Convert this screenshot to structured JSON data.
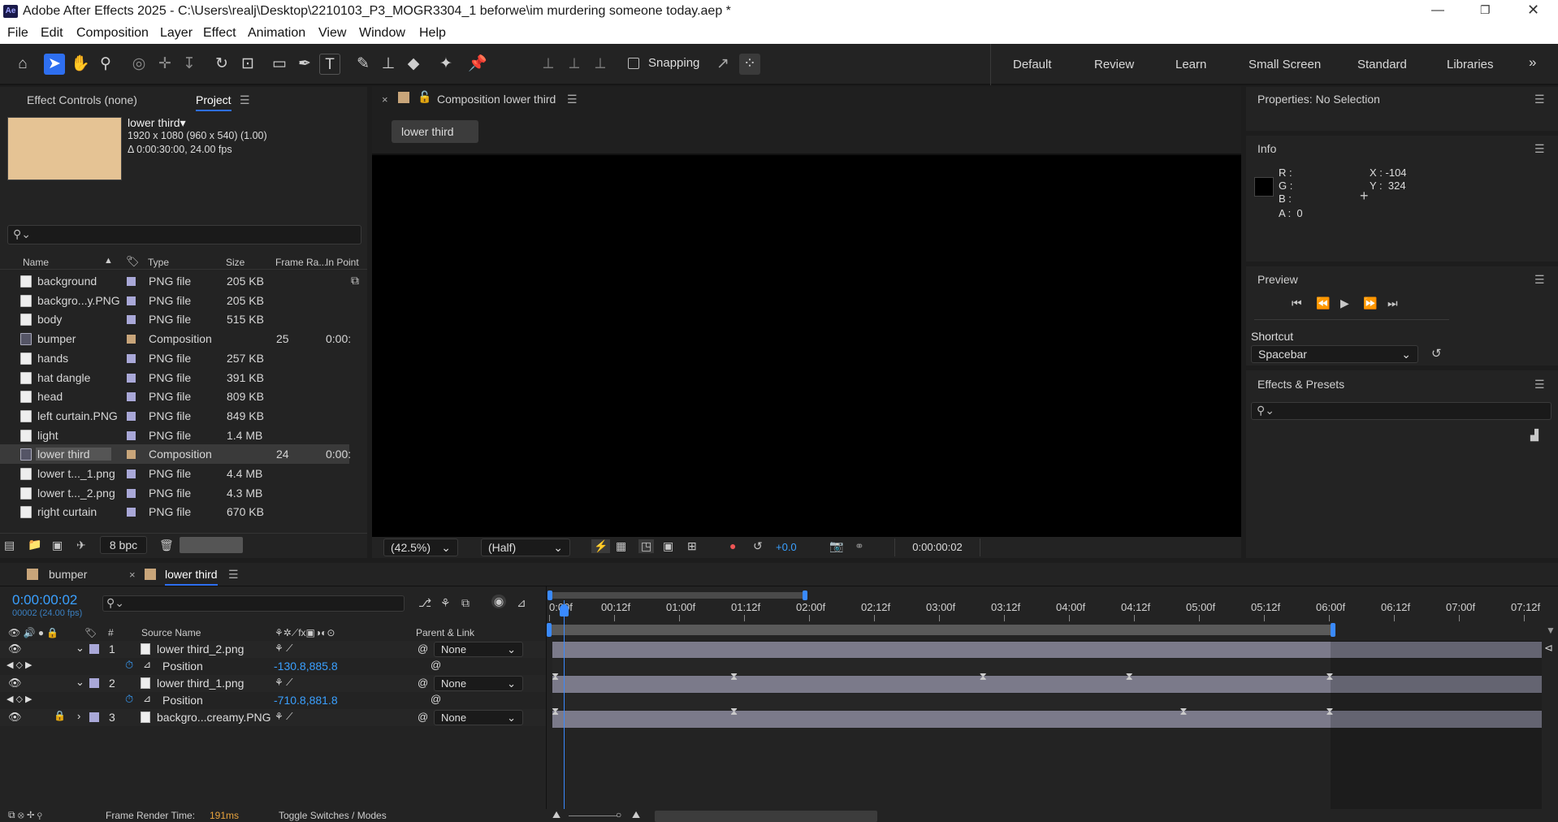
{
  "window": {
    "title": "Adobe After Effects 2025 - C:\\Users\\realj\\Desktop\\2210103_P3_MOGR3304_1 beforwe\\im murdering someone today.aep *",
    "app_icon": "Ae"
  },
  "menu": [
    "File",
    "Edit",
    "Composition",
    "Layer",
    "Effect",
    "Animation",
    "View",
    "Window",
    "Help"
  ],
  "toolbar": {
    "snapping_label": "Snapping",
    "workspaces": [
      "Default",
      "Review",
      "Learn",
      "Small Screen",
      "Standard",
      "Libraries"
    ],
    "more": "»"
  },
  "project_panel": {
    "tabs": [
      "Effect Controls (none)",
      "Project"
    ],
    "active_tab": "Project",
    "selected_item": {
      "name": "lower third▾",
      "line1": "1920 x 1080  (960 x 540) (1.00)",
      "line2": "Δ 0:00:30:00, 24.00 fps",
      "thumb_color": "#e5c394"
    },
    "search_placeholder": "",
    "columns": [
      "Name",
      "Type",
      "Size",
      "Frame Ra...",
      "In Point"
    ],
    "items": [
      {
        "name": "background",
        "type": "PNG file",
        "size": "205 KB",
        "fr": "",
        "ip": "",
        "kind": "png",
        "label": "#a9a8d8"
      },
      {
        "name": "backgro...y.PNG",
        "type": "PNG file",
        "size": "205 KB",
        "fr": "",
        "ip": "",
        "kind": "png",
        "label": "#a9a8d8"
      },
      {
        "name": "body",
        "type": "PNG file",
        "size": "515 KB",
        "fr": "",
        "ip": "",
        "kind": "png",
        "label": "#a9a8d8"
      },
      {
        "name": "bumper",
        "type": "Composition",
        "size": "",
        "fr": "25",
        "ip": "0:00:",
        "kind": "comp",
        "label": "#c8a57a"
      },
      {
        "name": "hands",
        "type": "PNG file",
        "size": "257 KB",
        "fr": "",
        "ip": "",
        "kind": "png",
        "label": "#a9a8d8"
      },
      {
        "name": "hat dangle",
        "type": "PNG file",
        "size": "391 KB",
        "fr": "",
        "ip": "",
        "kind": "png",
        "label": "#a9a8d8"
      },
      {
        "name": "head",
        "type": "PNG file",
        "size": "809 KB",
        "fr": "",
        "ip": "",
        "kind": "png",
        "label": "#a9a8d8"
      },
      {
        "name": "left curtain.PNG",
        "type": "PNG file",
        "size": "849 KB",
        "fr": "",
        "ip": "",
        "kind": "png",
        "label": "#a9a8d8"
      },
      {
        "name": "light",
        "type": "PNG file",
        "size": "1.4 MB",
        "fr": "",
        "ip": "",
        "kind": "png",
        "label": "#a9a8d8"
      },
      {
        "name": "lower third",
        "type": "Composition",
        "size": "",
        "fr": "24",
        "ip": "0:00:",
        "kind": "comp",
        "label": "#c8a57a",
        "selected": true
      },
      {
        "name": "lower t..._1.png",
        "type": "PNG file",
        "size": "4.4 MB",
        "fr": "",
        "ip": "",
        "kind": "png",
        "label": "#a9a8d8"
      },
      {
        "name": "lower t..._2.png",
        "type": "PNG file",
        "size": "4.3 MB",
        "fr": "",
        "ip": "",
        "kind": "png",
        "label": "#a9a8d8"
      },
      {
        "name": "right curtain",
        "type": "PNG file",
        "size": "670 KB",
        "fr": "",
        "ip": "",
        "kind": "png",
        "label": "#a9a8d8"
      }
    ],
    "bpc": "8 bpc"
  },
  "composition_panel": {
    "title": "Composition lower third",
    "tab": "lower third",
    "zoom": "(42.5%)",
    "resolution": "(Half)",
    "exposure": "+0.0",
    "timecode": "0:00:00:02"
  },
  "properties": {
    "title": "Properties: No Selection"
  },
  "info": {
    "title": "Info",
    "r": "R :",
    "g": "G :",
    "b": "B :",
    "a": "A :  0",
    "x": "X : -104",
    "y": "Y :  324"
  },
  "preview": {
    "title": "Preview",
    "shortcut_label": "Shortcut",
    "shortcut_value": "Spacebar"
  },
  "effects": {
    "title": "Effects & Presets",
    "search_placeholder": ""
  },
  "timeline": {
    "tabs": [
      "bumper",
      "lower third"
    ],
    "active_tab": "lower third",
    "timecode": "0:00:00:02",
    "frame_info": "00002 (24.00 fps)",
    "columns": {
      "source": "Source Name",
      "parent": "Parent & Link",
      "num": "#"
    },
    "layers": [
      {
        "num": "1",
        "name": "lower third_2.png",
        "parent": "None",
        "position": "-130.8,885.8",
        "expanded": true
      },
      {
        "num": "2",
        "name": "lower third_1.png",
        "parent": "None",
        "position": "-710.8,881.8",
        "expanded": true
      },
      {
        "num": "3",
        "name": "backgro...creamy.PNG",
        "parent": "None",
        "expanded": false
      }
    ],
    "property_label": "Position",
    "ruler": [
      "0:00f",
      "00:12f",
      "01:00f",
      "01:12f",
      "02:00f",
      "02:12f",
      "03:00f",
      "03:12f",
      "04:00f",
      "04:12f",
      "05:00f",
      "05:12f",
      "06:00f",
      "06:12f",
      "07:00f",
      "07:12f"
    ],
    "keyframes_layer1": [
      "0:00f",
      "01:09f",
      "03:07f",
      "04:10f",
      "05:23f"
    ],
    "keyframes_layer2": [
      "0:00f",
      "01:09f",
      "04:20f",
      "05:23f"
    ],
    "footer": {
      "render_label": "Frame Render Time:",
      "render_value": "191ms",
      "toggle": "Toggle Switches / Modes"
    }
  },
  "colors": {
    "accent": "#2e6ff0",
    "timecode": "#3aa0ff",
    "render_time": "#e8a33d"
  }
}
